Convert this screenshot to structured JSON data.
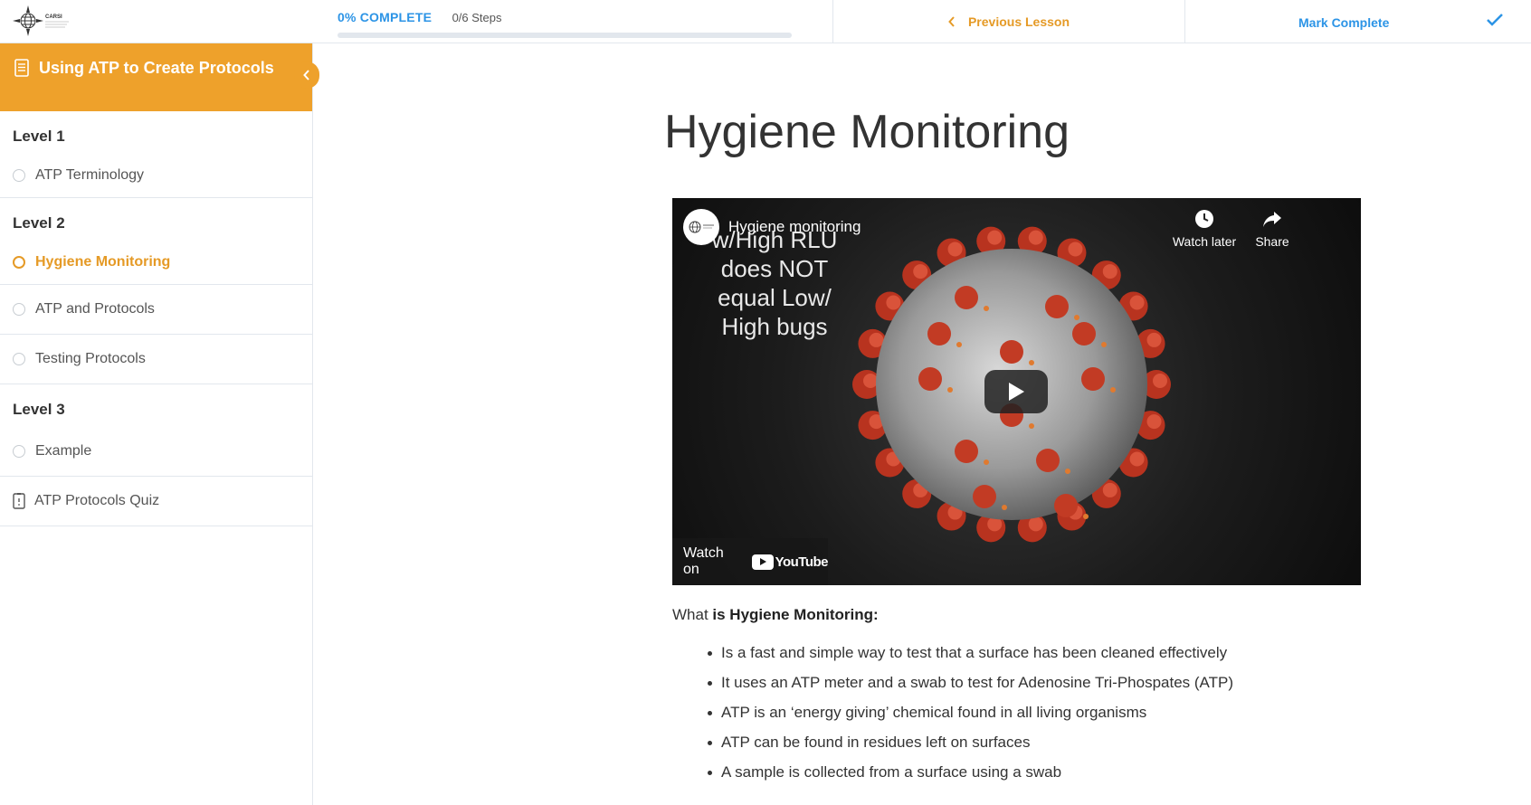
{
  "header": {
    "logo_text": "CARSI",
    "progress_percent_label": "0% COMPLETE",
    "progress_steps": "0/6 Steps",
    "progress_fraction": 0,
    "previous_lesson": "Previous Lesson",
    "mark_complete": "Mark Complete"
  },
  "sidebar": {
    "course_title": "Using ATP to Create Protocols",
    "sections": [
      {
        "level": "Level 1",
        "lessons": [
          {
            "label": "ATP Terminology",
            "active": false
          }
        ]
      },
      {
        "level": "Level 2",
        "lessons": [
          {
            "label": "Hygiene Monitoring",
            "active": true
          },
          {
            "label": "ATP and Protocols",
            "active": false
          },
          {
            "label": "Testing Protocols",
            "active": false
          }
        ]
      },
      {
        "level": "Level 3",
        "lessons": [
          {
            "label": "Example",
            "active": false
          }
        ]
      }
    ],
    "quiz": "ATP Protocols Quiz"
  },
  "main": {
    "title": "Hygiene Monitoring",
    "video": {
      "title": "Hygiene monitoring",
      "overlay_text": [
        "w/High RLU",
        "does NOT",
        "equal Low/",
        "High bugs"
      ],
      "watch_later": "Watch later",
      "share": "Share",
      "watch_on": "Watch on",
      "youtube": "YouTube"
    },
    "intro_prefix": "What ",
    "intro_bold": "is Hygiene Monitoring:",
    "bullets": [
      "Is a fast and simple way to test that a surface has been cleaned effectively",
      "It uses an ATP meter and a swab to test for Adenosine Tri-Phospates (ATP)",
      "ATP is an ‘energy giving’ chemical found in all living organisms",
      "ATP can be found in residues left on surfaces",
      "A sample is collected from a surface using a swab"
    ]
  },
  "colors": {
    "accent_orange": "#eea12b",
    "accent_blue": "#2c94e6"
  }
}
